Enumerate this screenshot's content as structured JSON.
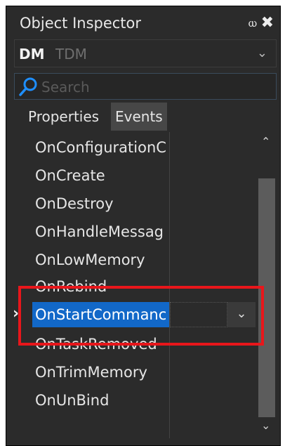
{
  "panel": {
    "title": "Object Inspector",
    "pin_glyph": "ⲱ",
    "close_glyph": "✖"
  },
  "object_selector": {
    "name": "DM",
    "type": "TDM",
    "dropdown_glyph": "⌄"
  },
  "search": {
    "placeholder": "Search"
  },
  "tabs": [
    {
      "label": "Properties",
      "active": false
    },
    {
      "label": "Events",
      "active": true
    }
  ],
  "events": [
    {
      "name": "OnConfigurationC"
    },
    {
      "name": "OnCreate"
    },
    {
      "name": "OnDestroy"
    },
    {
      "name": "OnHandleMessag"
    },
    {
      "name": "OnLowMemory"
    },
    {
      "name": "OnRebind"
    },
    {
      "name": "OnStartCommanc",
      "selected": true
    },
    {
      "name": "OnTaskRemoved"
    },
    {
      "name": "OnTrimMemory"
    },
    {
      "name": "OnUnBind"
    }
  ],
  "scrollbar": {
    "up_glyph": "⌃",
    "down_glyph": "⌄"
  },
  "colors": {
    "selection": "#1268c8",
    "highlight_box": "#e8161b",
    "background": "#2b2b2b"
  }
}
